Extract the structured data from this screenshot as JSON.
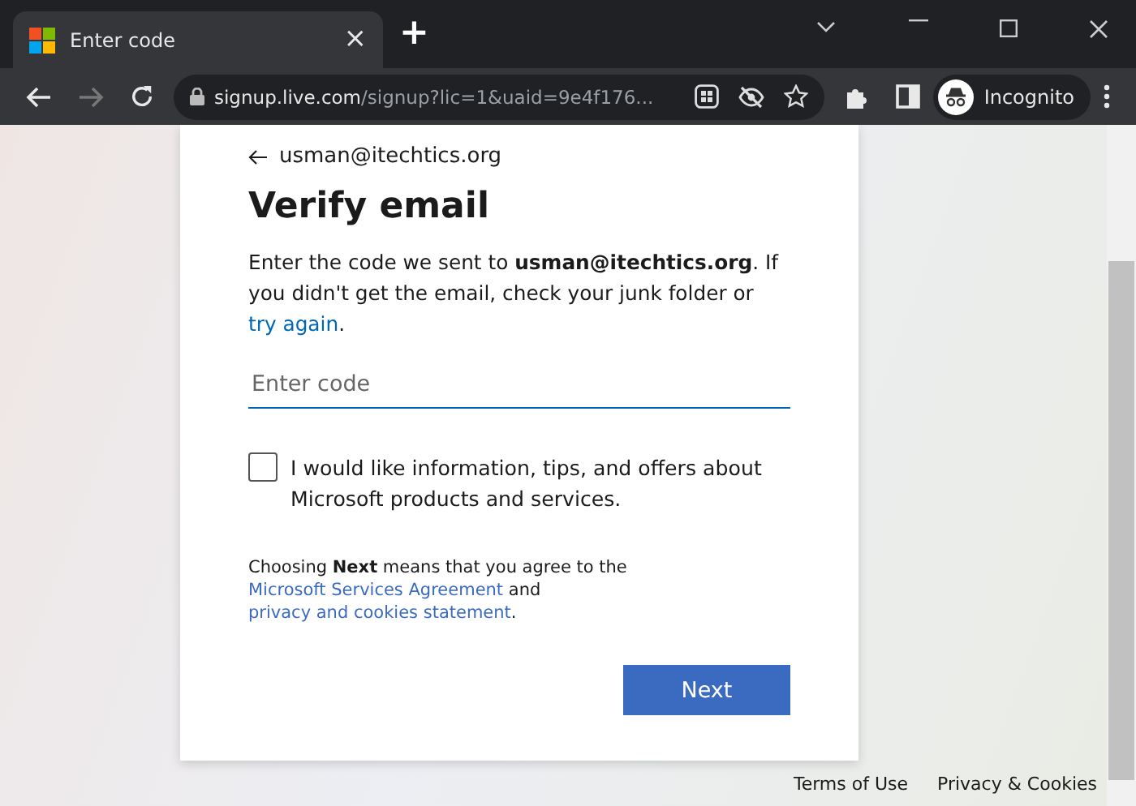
{
  "tab": {
    "title": "Enter code",
    "close": "×"
  },
  "new_tab": "+",
  "nav": [
    {
      "kind": "back",
      "disabled": false
    },
    {
      "kind": "forward",
      "disabled": true
    },
    {
      "kind": "reload",
      "disabled": false
    }
  ],
  "address": {
    "host": "signup.live.com",
    "path": "/signup?lic=1&uaid=9e4f176..."
  },
  "profile": {
    "label": "Incognito"
  },
  "card": {
    "back_email": "usman@itechtics.org",
    "heading": "Verify email",
    "message": {
      "before": "Enter the code we sent to **usman@itechtics.org**. If you didn't get the email, check your junk folder or ",
      "link": "try again",
      "after": "."
    },
    "code_field": {
      "placeholder": "Enter code"
    },
    "consent": {
      "label": "I would like information, tips, and offers about Microsoft products and services.",
      "checked": false
    },
    "legal": {
      "before": "Choosing **Next** means that you agree to the ",
      "link1": "Microsoft Services Agreement",
      "middle": " and ",
      "link2": "privacy and cookies statement",
      "after": "."
    },
    "button": "Next"
  },
  "footer": [
    "Terms of Use",
    "Privacy & Cookies"
  ]
}
